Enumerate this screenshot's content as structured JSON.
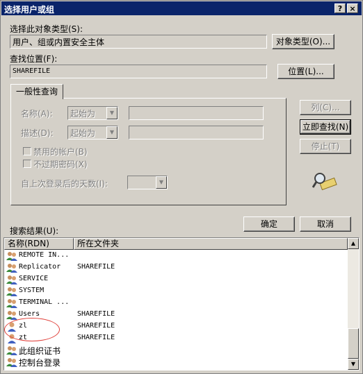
{
  "window": {
    "title": "选择用户或组",
    "help_btn": "?",
    "close_btn": "×"
  },
  "object_type": {
    "label": "选择此对象类型(S):",
    "value": "用户、组或内置安全主体",
    "button": "对象类型(O)..."
  },
  "location": {
    "label": "查找位置(F):",
    "value": "SHAREFILE",
    "button": "位置(L)..."
  },
  "tab": {
    "label": "一般性查询"
  },
  "query": {
    "name_label": "名称(A):",
    "name_mode": "起始为",
    "desc_label": "描述(D):",
    "desc_mode": "起始为",
    "disabled_accounts": "禁用的帐户(B)",
    "no_expire_pwd": "不过期密码(X)",
    "days_label": "自上次登录后的天数(I):",
    "days_value": ""
  },
  "side_buttons": {
    "columns": "列(C)...",
    "find_now": "立即查找(N)",
    "stop": "停止(T)"
  },
  "search_icon": "magnifier-search-icon",
  "results": {
    "label": "搜索结果(U):",
    "columns": [
      "名称(RDN)",
      "所在文件夹"
    ],
    "rows": [
      {
        "name": "REMOTE IN...",
        "folder": "",
        "icon": "group-icon"
      },
      {
        "name": "Replicator",
        "folder": "SHAREFILE",
        "icon": "group-icon"
      },
      {
        "name": "SERVICE",
        "folder": "",
        "icon": "group-icon"
      },
      {
        "name": "SYSTEM",
        "folder": "",
        "icon": "group-icon"
      },
      {
        "name": "TERMINAL ...",
        "folder": "",
        "icon": "group-icon"
      },
      {
        "name": "Users",
        "folder": "SHAREFILE",
        "icon": "group-icon"
      },
      {
        "name": "zl",
        "folder": "SHAREFILE",
        "icon": "user-icon"
      },
      {
        "name": "zt",
        "folder": "SHAREFILE",
        "icon": "user-icon"
      },
      {
        "name": "此组织证书",
        "folder": "",
        "icon": "group-icon"
      },
      {
        "name": "控制台登录",
        "folder": "",
        "icon": "group-icon"
      }
    ]
  },
  "dialog_buttons": {
    "ok": "确定",
    "cancel": "取消"
  },
  "colors": {
    "titlebar": "#0a246a",
    "face": "#d4d0c8",
    "highlight_ellipse": "#e0403a"
  }
}
